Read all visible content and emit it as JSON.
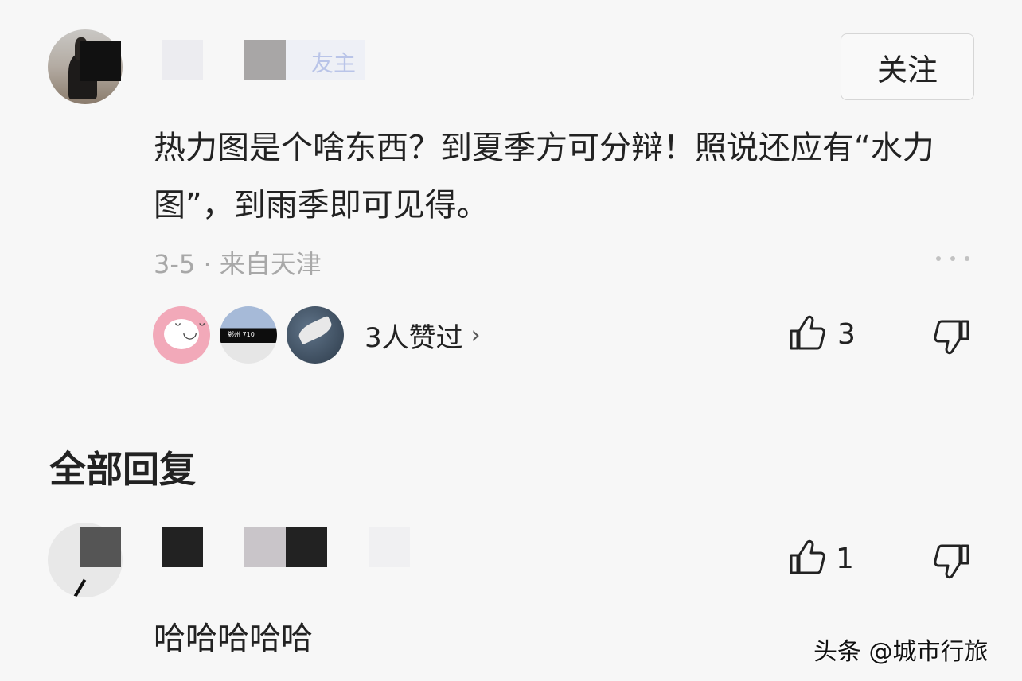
{
  "comment": {
    "username": "",
    "username_badge": "友主",
    "follow_label": "关注",
    "text": "热力图是个啥东西？到夏季方可分辩！照说还应有“水力图”，到雨季即可见得。",
    "time": "3-5",
    "separator": "·",
    "location": "来自天津",
    "likers_summary": "3人赞过",
    "likers_chevron": "›",
    "like_count": "3",
    "liker_2_tag": "鄭州 710"
  },
  "replies": {
    "section_title": "全部回复",
    "items": [
      {
        "username": "",
        "text": "哈哈哈哈哈",
        "like_count": "1"
      }
    ]
  },
  "watermark": "头条 @城市行旅",
  "icons": {
    "like": "thumbs-up-icon",
    "dislike": "thumbs-down-icon",
    "more": "more-dots-icon"
  },
  "colors": {
    "background": "#f7f7f7",
    "text": "#222222",
    "meta_text": "#a8a8a8"
  }
}
